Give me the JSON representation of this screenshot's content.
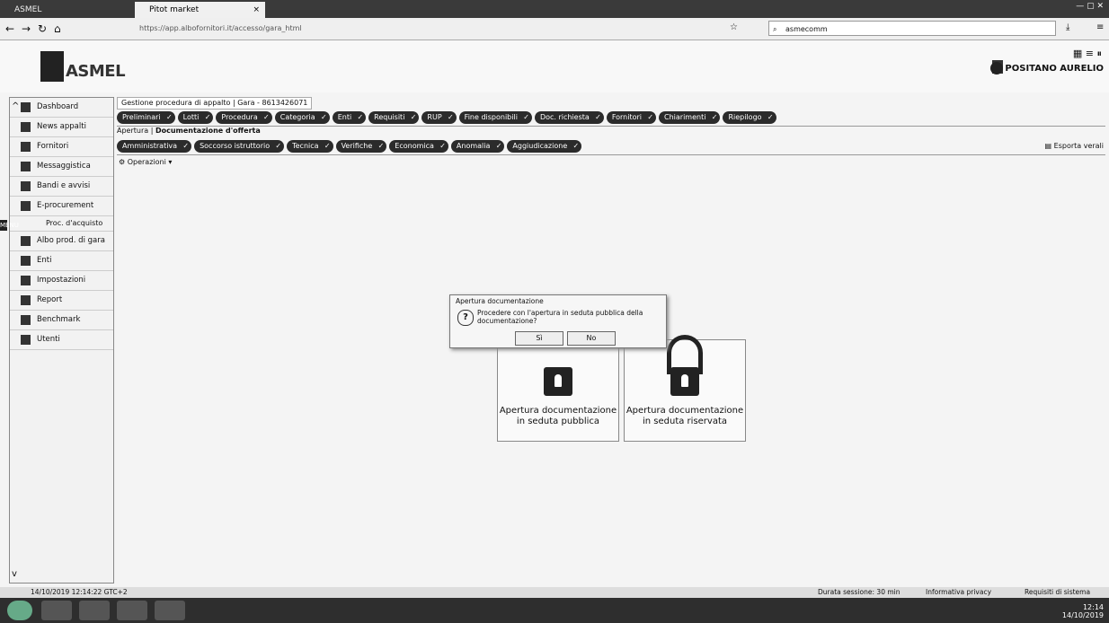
{
  "browser": {
    "tabs": [
      {
        "label": "ASMEL"
      },
      {
        "label": "Pitot market",
        "close": "×"
      }
    ],
    "url": "https://app.albofornitori.it/accesso/gara_html",
    "search_placeholder": "asmecomm",
    "nav_icons": [
      "back-icon",
      "forward-icon",
      "reload-icon",
      "home-icon"
    ]
  },
  "app": {
    "logo_text": "ASMEL",
    "user_name": "POSITANO AURELIO"
  },
  "sidebar": {
    "items": [
      {
        "label": "Dashboard"
      },
      {
        "label": "News appalti"
      },
      {
        "label": "Fornitori"
      },
      {
        "label": "Messaggistica"
      },
      {
        "label": "Bandi e avvisi"
      },
      {
        "label": "E-procurement"
      },
      {
        "label": "Proc. d'acquisto",
        "sub": true
      },
      {
        "label": "Albo prod. di gara"
      },
      {
        "label": "Enti"
      },
      {
        "label": "Impostazioni"
      },
      {
        "label": "Report"
      },
      {
        "label": "Benchmark"
      },
      {
        "label": "Utenti"
      }
    ],
    "menu_label": "MENU"
  },
  "main": {
    "crumb": "Gestione procedura di appalto  |  Gara - 8613426071",
    "pills_row1": [
      "Preliminari",
      "Lotti",
      "Procedura",
      "Categoria",
      "Enti",
      "Requisiti",
      "RUP",
      "Fine disponibili",
      "Doc. richiesta",
      "Fornitori",
      "Chiarimenti",
      "Riepilogo"
    ],
    "crumb2_prefix": "Apertura   |",
    "crumb2_bold": "Documentazione d'offerta",
    "pills_row2": [
      "Amministrativa",
      "Soccorso istruttorio",
      "Tecnica",
      "Verifiche",
      "Economica",
      "Anomalia",
      "Aggiudicazione"
    ],
    "export": "Esporta verali",
    "operations": "Operazioni",
    "cards": [
      {
        "label": "Apertura documentazione in seduta pubblica"
      },
      {
        "label": "Apertura documentazione in seduta riservata"
      }
    ]
  },
  "dialog": {
    "title": "Apertura documentazione",
    "message": "Procedere con l'apertura in seduta pubblica della documentazione?",
    "yes": "Sì",
    "no": "No"
  },
  "footer": {
    "timestamp": "14/10/2019 12:14:22 GTC+2",
    "session": "Durata sessione: 30 min",
    "privacy": "Informativa privacy",
    "requirements": "Requisiti di sistema"
  },
  "tray": {
    "time": "12:14",
    "date": "14/10/2019"
  },
  "colors": {
    "pill_dark": "#2b2b2b",
    "pill_red": "#7a1818"
  }
}
